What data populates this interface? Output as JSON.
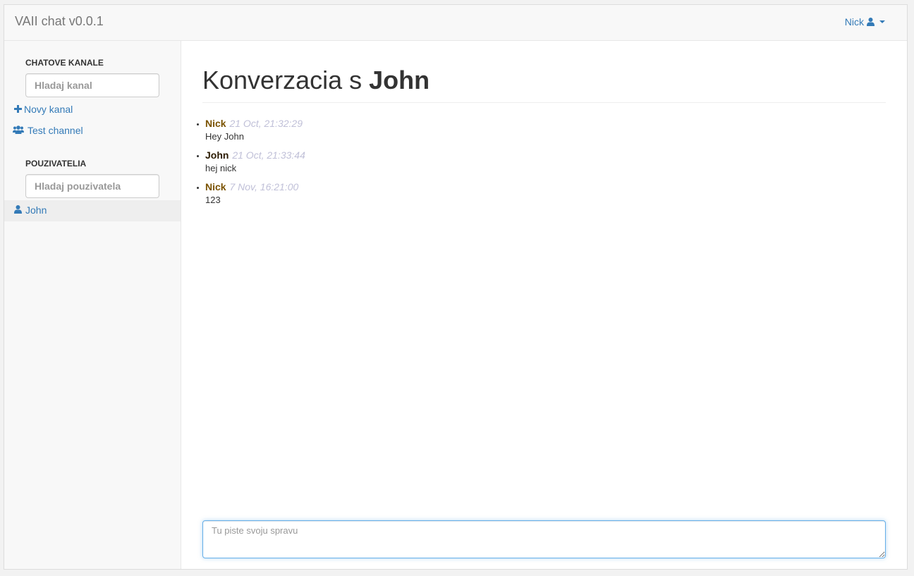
{
  "app": {
    "title": "VAII chat v0.0.1"
  },
  "user_menu": {
    "name": "Nick"
  },
  "sidebar": {
    "channels_title": "CHATOVE KANALE",
    "channels_search_placeholder": "Hladaj kanal",
    "new_channel_label": "Novy kanal",
    "channels": [
      {
        "label": "Test channel"
      }
    ],
    "users_title": "POUZIVATELIA",
    "users_search_placeholder": "Hladaj pouzivatela",
    "users": [
      {
        "label": "John",
        "selected": true
      }
    ]
  },
  "conversation": {
    "heading_prefix": "Konverzacia s",
    "partner": "John",
    "messages": [
      {
        "author": "Nick",
        "time": "21 Oct, 21:32:29",
        "text": "Hey John"
      },
      {
        "author": "John",
        "time": "21 Oct, 21:33:44",
        "text": "hej nick"
      },
      {
        "author": "Nick",
        "time": "7 Nov, 16:21:00",
        "text": "123"
      }
    ]
  },
  "composer": {
    "placeholder": "Tu piste svoju spravu",
    "value": ""
  },
  "colors": {
    "link": "#337ab7",
    "nick_author": "#7a5200",
    "john_author": "#2a1a00",
    "timestamp": "#c0c0d8",
    "focus_border": "#66afe9"
  },
  "icons": {
    "user_menu": "user-icon",
    "user_menu_caret": "caret-down-icon",
    "new_channel": "plus-icon",
    "channel": "users-icon",
    "user": "user-icon"
  }
}
